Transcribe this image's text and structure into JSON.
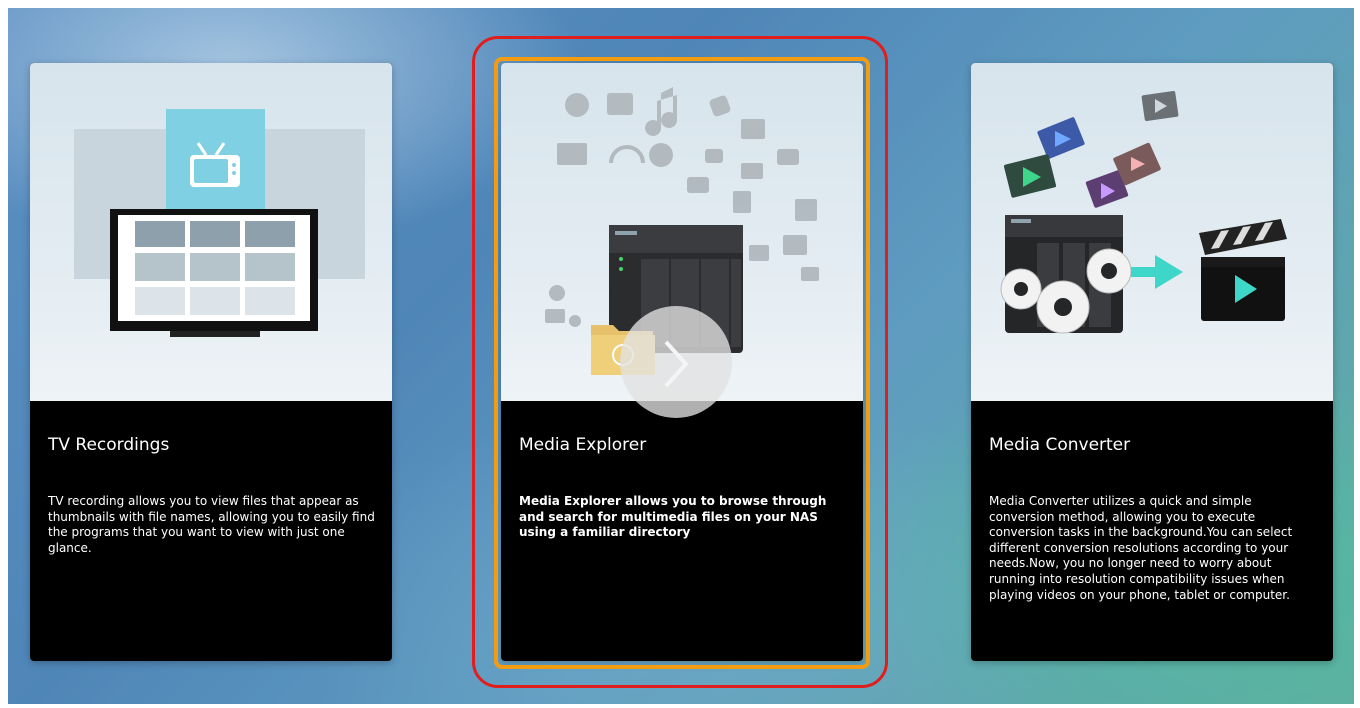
{
  "cards": [
    {
      "title": "TV Recordings",
      "description": "TV recording allows you to view files that appear as thumbnails with file names, allowing you to easily find the programs that you want to view with just one glance.",
      "icon": "tv-recordings-illustration"
    },
    {
      "title": "Media Explorer",
      "description": "Media Explorer allows you to browse through and search for multimedia files on your NAS using a familiar directory",
      "icon": "media-explorer-illustration",
      "selected": true
    },
    {
      "title": "Media Converter",
      "description": "Media Converter utilizes a quick and simple conversion method, allowing you to execute conversion tasks in the background.You can select different conversion resolutions according to your needs.Now, you no longer need to worry about running into resolution compatibility issues when playing videos on your phone, tablet or computer.",
      "icon": "media-converter-illustration"
    }
  ],
  "colors": {
    "highlight_outer": "#e01e1e",
    "highlight_inner": "#f39c12",
    "accent_teal": "#3ed6c8"
  },
  "next_button_icon": "chevron-right-icon"
}
